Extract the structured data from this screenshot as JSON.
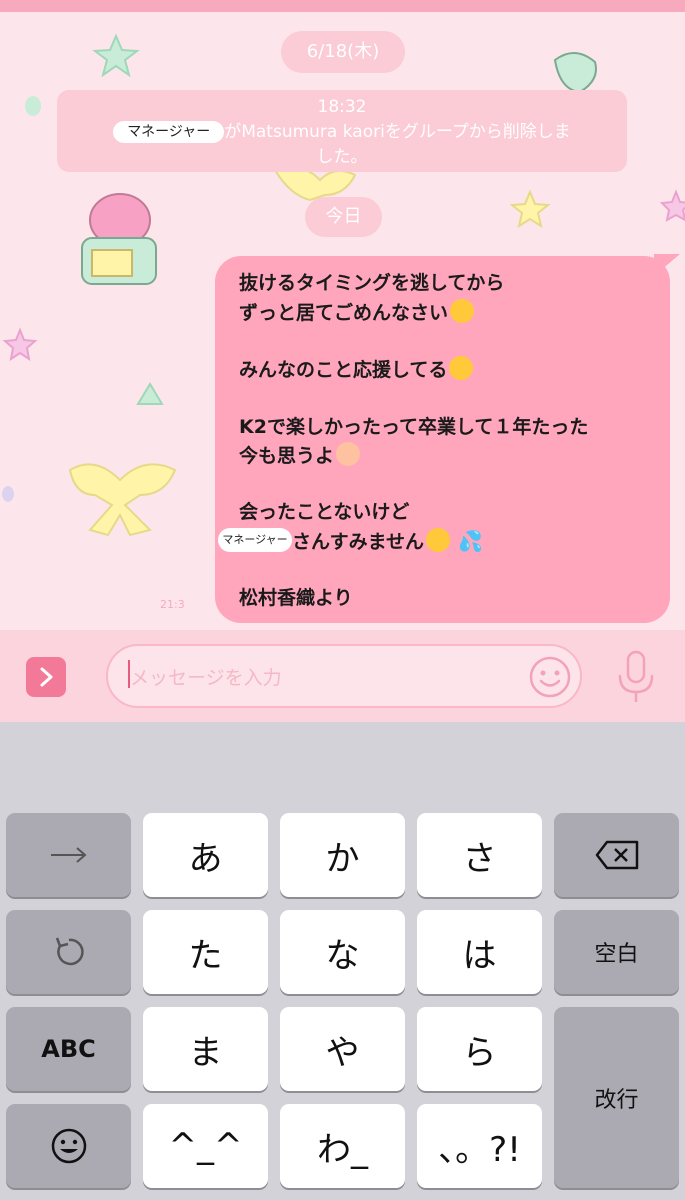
{
  "chat": {
    "date_pill": "6/18(木)",
    "notice": {
      "time": "18:32",
      "censored_name": "マネージャー",
      "text_part1": "がMatsumura kaoriをグループから削除しま",
      "text_part2": "した。"
    },
    "today_pill": "今日",
    "message": {
      "line1": "抜けるタイミングを逃してから",
      "line2": "ずっと居てごめんなさい",
      "line3": "みんなのこと応援してる",
      "line4": "K2で楽しかったって卒業して１年たった",
      "line5": "今も思うよ",
      "line6": "会ったことないけど",
      "line7_censored": "マネージャー",
      "line7": "さんすみません",
      "line8": "松村香織より"
    },
    "sent_time": "21:3"
  },
  "input": {
    "placeholder": "メッセージを入力"
  },
  "keyboard": {
    "rows": [
      [
        "→",
        "あ",
        "か",
        "さ",
        "⌫"
      ],
      [
        "↺",
        "た",
        "な",
        "は",
        "空白"
      ],
      [
        "ABC",
        "ま",
        "や",
        "ら",
        "改行"
      ],
      [
        "☺",
        "^_^",
        "わ_",
        "、。?!"
      ]
    ]
  },
  "colors": {
    "accent": "#f27a98",
    "bubble": "#ffa6bd",
    "pill": "#fbcbd6",
    "chat_bg": "#fde6eb"
  }
}
